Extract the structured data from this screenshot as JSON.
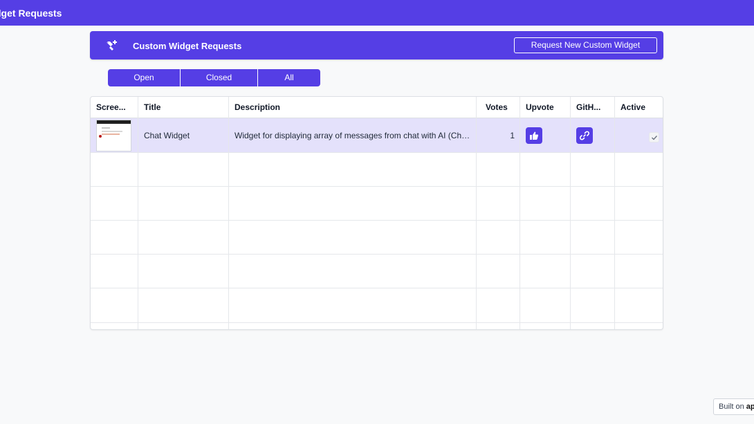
{
  "app": {
    "title": "dget Requests"
  },
  "header": {
    "icon": "widget-add-icon",
    "title": "Custom Widget Requests",
    "request_button": "Request New Custom Widget"
  },
  "filters": {
    "tabs": [
      {
        "label": "Open",
        "selected": true
      },
      {
        "label": "Closed",
        "selected": false
      },
      {
        "label": "All",
        "selected": false
      }
    ]
  },
  "table": {
    "columns": [
      "Scree...",
      "Title",
      "Description",
      "Votes",
      "Upvote",
      "GitH...",
      "Active"
    ],
    "rows": [
      {
        "screenshot": "chat-widget-thumbnail",
        "title": "Chat Widget",
        "description": "Widget for displaying array of messages from chat with AI (ChatGPT,...",
        "votes": "1",
        "upvote_icon": "thumbs-up-icon",
        "github_icon": "link-icon",
        "active": true
      }
    ]
  },
  "footer": {
    "built_on": "Built on",
    "brand": "ap"
  },
  "colors": {
    "accent": "#553ee5",
    "selected_row": "#e4e1fb",
    "background": "#f8f9fa"
  }
}
